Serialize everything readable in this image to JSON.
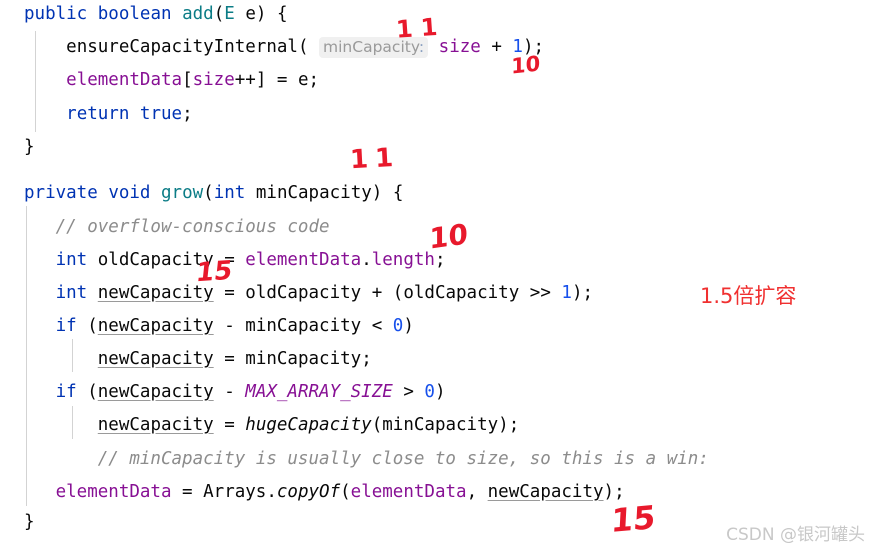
{
  "editor": {
    "background": "#ffffff",
    "foreground": "#080808",
    "language": "java",
    "colors": {
      "keyword": "#0033b3",
      "type": "#0b7c86",
      "field": "#871094",
      "number": "#1750eb",
      "comment": "#8c8c8c",
      "static_field": "#871094",
      "indent_guide": "#d3d3d3",
      "hint_background": "#f0f0f0",
      "annotation_red": "#e8192c",
      "note_red": "#f03030",
      "watermark": "#c8c8c8"
    },
    "lines": [
      {
        "id": 1,
        "text": "public boolean add(E e) {"
      },
      {
        "id": 2,
        "text": "    ensureCapacityInternal( minCapacity: size + 1);"
      },
      {
        "id": 3,
        "text": "    elementData[size++] = e;"
      },
      {
        "id": 4,
        "text": "    return true;"
      },
      {
        "id": 5,
        "text": "}"
      },
      {
        "id": 6,
        "text": ""
      },
      {
        "id": 7,
        "text": "private void grow(int minCapacity) {"
      },
      {
        "id": 8,
        "text": "    // overflow-conscious code"
      },
      {
        "id": 9,
        "text": "    int oldCapacity = elementData.length;"
      },
      {
        "id": 10,
        "text": "    int newCapacity = oldCapacity + (oldCapacity >> 1);"
      },
      {
        "id": 11,
        "text": "    if (newCapacity - minCapacity < 0)"
      },
      {
        "id": 12,
        "text": "        newCapacity = minCapacity;"
      },
      {
        "id": 13,
        "text": "    if (newCapacity - MAX_ARRAY_SIZE > 0)"
      },
      {
        "id": 14,
        "text": "        newCapacity = hugeCapacity(minCapacity);"
      },
      {
        "id": 15,
        "text": "    // minCapacity is usually close to size, so this is a win:"
      },
      {
        "id": 16,
        "text": "    elementData = Arrays.copyOf(elementData, newCapacity);"
      },
      {
        "id": 17,
        "text": "}"
      }
    ],
    "tokens": {
      "kw_public": "public",
      "kw_boolean": "boolean",
      "method_add": "add",
      "type_E": "E",
      "param_e": "e",
      "call_ensure": "ensureCapacityInternal",
      "hint_name": "minCapacity",
      "hint_colon": ":",
      "field_size": "size",
      "num_1": "1",
      "field_elementData": "elementData",
      "kw_return": "return",
      "kw_true": "true",
      "kw_private": "private",
      "kw_void": "void",
      "method_grow": "grow",
      "kw_int": "int",
      "var_minCapacity": "minCapacity",
      "comment_overflow": "// overflow-conscious code",
      "var_oldCapacity": "oldCapacity",
      "prop_length": "length",
      "var_newCapacity": "newCapacity",
      "kw_if": "if",
      "num_0": "0",
      "static_max": "MAX_ARRAY_SIZE",
      "method_huge": "hugeCapacity",
      "class_Arrays": "Arrays",
      "method_copyOf": "copyOf"
    }
  },
  "annotations": {
    "ink_marks": [
      {
        "name": "ink-11-near-grow",
        "text": "11",
        "meaning": "handwritten eleven above grow signature"
      },
      {
        "name": "ink-11-near-hint",
        "text": "11",
        "meaning": "handwritten eleven above minCapacity hint"
      },
      {
        "name": "ink-10-near-size",
        "text": "10",
        "meaning": "handwritten ten under size + 1"
      },
      {
        "name": "ink-10-near-length",
        "text": "10",
        "meaning": "handwritten ten above elementData.length"
      },
      {
        "name": "ink-15-near-oldcapacity",
        "text": "15",
        "meaning": "handwritten fifteen under oldCapacity"
      },
      {
        "name": "ink-15-bottom",
        "text": "15",
        "meaning": "handwritten fifteen under newCapacity in copyOf"
      }
    ],
    "note_cn": "1.5倍扩容"
  },
  "watermark": {
    "text": "CSDN @银河罐头"
  }
}
